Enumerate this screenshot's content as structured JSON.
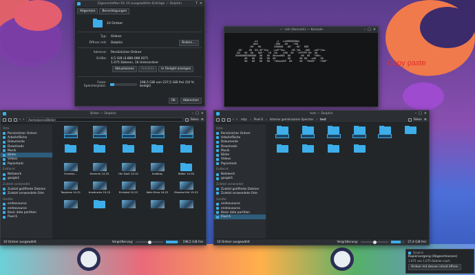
{
  "annotation": "Copy paste",
  "props": {
    "title": "Eigenschaften für 10 ausgewählte Einträge — Dolphin",
    "tabs": [
      "Allgemein",
      "Berechtigungen"
    ],
    "name": "10 Ordner",
    "type_key": "Typ:",
    "type_val": "Ordner",
    "open_key": "Öffnen mit:",
    "open_val": "Dolphin",
    "change_btn": "Ändern ...",
    "addr_key": "Adresse:",
    "addr_val": "Persönlicher Ordner",
    "size_key": "Größe:",
    "size_val": "4,5 GiB (4.880.086.927)",
    "size_sub": "1.075 Dateien, 16 Unterordner",
    "btn_refresh": "Aktualisieren",
    "btn_stop": "Anhalten",
    "btn_filelight": "In Filelight anzeigen",
    "free_key": "Freier Speicherplatz:",
    "free_val": "198,5 GiB von 237,5 GiB frei (16 % belegt)",
    "ok": "OK",
    "cancel": "Abbrechen"
  },
  "term": {
    "title": "~ : zsh (Konsole) — Konsole",
    "art": "             .oo            .o  .oo8888888bo\n            .888           .888  .88   `Y88\n          .88'  88.        888888  .88'  .88'  888\n  .88'    88  88.dP\"Ybo.  ,odP\"Ybo.   .88 YbL  ,888  ,odP\"Ybo.\n .88'  88  88   88P'  `Y8  88    888  88  `YPPPPP'88  88  `\n 88888888888888  88   88  88ooo888  88       88  88  `Y88o.\n       88   88   88   88  88        88      88 88   od8   88\n       88   88   88   88  `Y8bood8P  88     88  `Y888P'  `Y88P'"
  },
  "left": {
    "title": "Bilder — Dolphin",
    "path": "/home/jannis/Bilder/",
    "split_label": "Teilen",
    "places": [
      {
        "h": "Orte"
      },
      {
        "l": "Persönlicher Ordner"
      },
      {
        "l": "Arbeitsfläche"
      },
      {
        "l": "Dokumente"
      },
      {
        "l": "Downloads"
      },
      {
        "l": "Musik"
      },
      {
        "l": "Bilder",
        "on": true
      },
      {
        "l": "Videos"
      },
      {
        "l": "Papierkorb"
      },
      {
        "h": "Entfernt"
      },
      {
        "l": "Netzwerk"
      },
      {
        "l": "google1"
      },
      {
        "h": "Zuletzt verwendet"
      },
      {
        "l": "Zuletzt geöffnete Dateien"
      },
      {
        "l": "Zuletzt verwendete Orte"
      },
      {
        "h": "Geräte"
      },
      {
        "l": "endeavouros"
      },
      {
        "l": "endeavouros"
      },
      {
        "l": "Basic data partition"
      },
      {
        "l": "Pixel 6"
      }
    ],
    "items": [
      {
        "k": "img",
        "n": "",
        "s": true
      },
      {
        "k": "img",
        "n": "",
        "s": true
      },
      {
        "k": "img",
        "n": "",
        "s": true
      },
      {
        "k": "img",
        "n": "",
        "s": true
      },
      {
        "k": "img",
        "n": "",
        "s": true
      },
      {
        "k": "fd",
        "n": ""
      },
      {
        "k": "fd",
        "n": ""
      },
      {
        "k": "fd",
        "n": ""
      },
      {
        "k": "fd",
        "n": ""
      },
      {
        "k": "fd",
        "n": ""
      },
      {
        "k": "img",
        "n": "Screens..."
      },
      {
        "k": "img",
        "n": "Hsmmm 14.32"
      },
      {
        "k": "img",
        "n": "Hin Easti 10.32"
      },
      {
        "k": "img",
        "n": "Indiatos"
      },
      {
        "k": "fd",
        "n": "Bilder 14.50"
      },
      {
        "k": "img",
        "n": "Taquinas 14.22"
      },
      {
        "k": "img",
        "n": "Ausdrucks 19.22"
      },
      {
        "k": "img",
        "n": "Erckstot 10.22"
      },
      {
        "k": "img",
        "n": "Kolla Elmo 16.22"
      },
      {
        "k": "img",
        "n": "Monsta Krik 15.22"
      },
      {
        "k": "img",
        "n": ""
      },
      {
        "k": "fd",
        "n": ""
      },
      {
        "k": "img",
        "n": ""
      },
      {
        "k": "img",
        "n": ""
      },
      {
        "k": "img",
        "n": ""
      }
    ],
    "status": "10 Ordner ausgewählt",
    "zoom": "Vergrößerung:",
    "free": "198,5 GiB frei"
  },
  "right": {
    "title": "test — Dolphin",
    "path": [
      "mtp:",
      "Pixel 6",
      "Interner gemeinsamer Speicher",
      "test"
    ],
    "split_label": "Teilen",
    "places": [
      {
        "h": "Orte"
      },
      {
        "l": "Persönlicher Ordner"
      },
      {
        "l": "Arbeitsfläche"
      },
      {
        "l": "Dokumente"
      },
      {
        "l": "Downloads"
      },
      {
        "l": "Musik"
      },
      {
        "l": "Bilder"
      },
      {
        "l": "Videos"
      },
      {
        "l": "Papierkorb"
      },
      {
        "h": "Entfernt"
      },
      {
        "l": "Netzwerk"
      },
      {
        "l": "google1"
      },
      {
        "h": "Zuletzt verwendet"
      },
      {
        "l": "Zuletzt geöffnete Dateien"
      },
      {
        "l": "Zuletzt verwendete Orte"
      },
      {
        "h": "Geräte"
      },
      {
        "l": "endeavouros"
      },
      {
        "l": "endeavouros"
      },
      {
        "l": "Basic data partition"
      },
      {
        "l": "Pixel 6",
        "on": true
      }
    ],
    "items": [
      {
        "k": "fd",
        "n": "",
        "s": true
      },
      {
        "k": "fd",
        "n": "",
        "s": true
      },
      {
        "k": "fd",
        "n": "",
        "s": true
      },
      {
        "k": "fd",
        "n": "",
        "s": true
      },
      {
        "k": "fd",
        "n": "",
        "s": true
      },
      {
        "k": "fd",
        "n": ""
      },
      {
        "k": "fd",
        "n": ""
      },
      {
        "k": "fd",
        "n": ""
      },
      {
        "k": "fd",
        "n": ""
      },
      {
        "k": "fd",
        "n": ""
      }
    ],
    "status": "10 Ordner ausgewählt",
    "zoom": "Vergrößerung:",
    "free": "27,4 GiB frei"
  },
  "notify": {
    "app": "Dolphin",
    "title": "Kopiervorgang (Abgeschlossen)",
    "text": "1.075 von 1.075 Dateien nach",
    "action": "Ordner mit dessen Inhalt öffnen"
  }
}
